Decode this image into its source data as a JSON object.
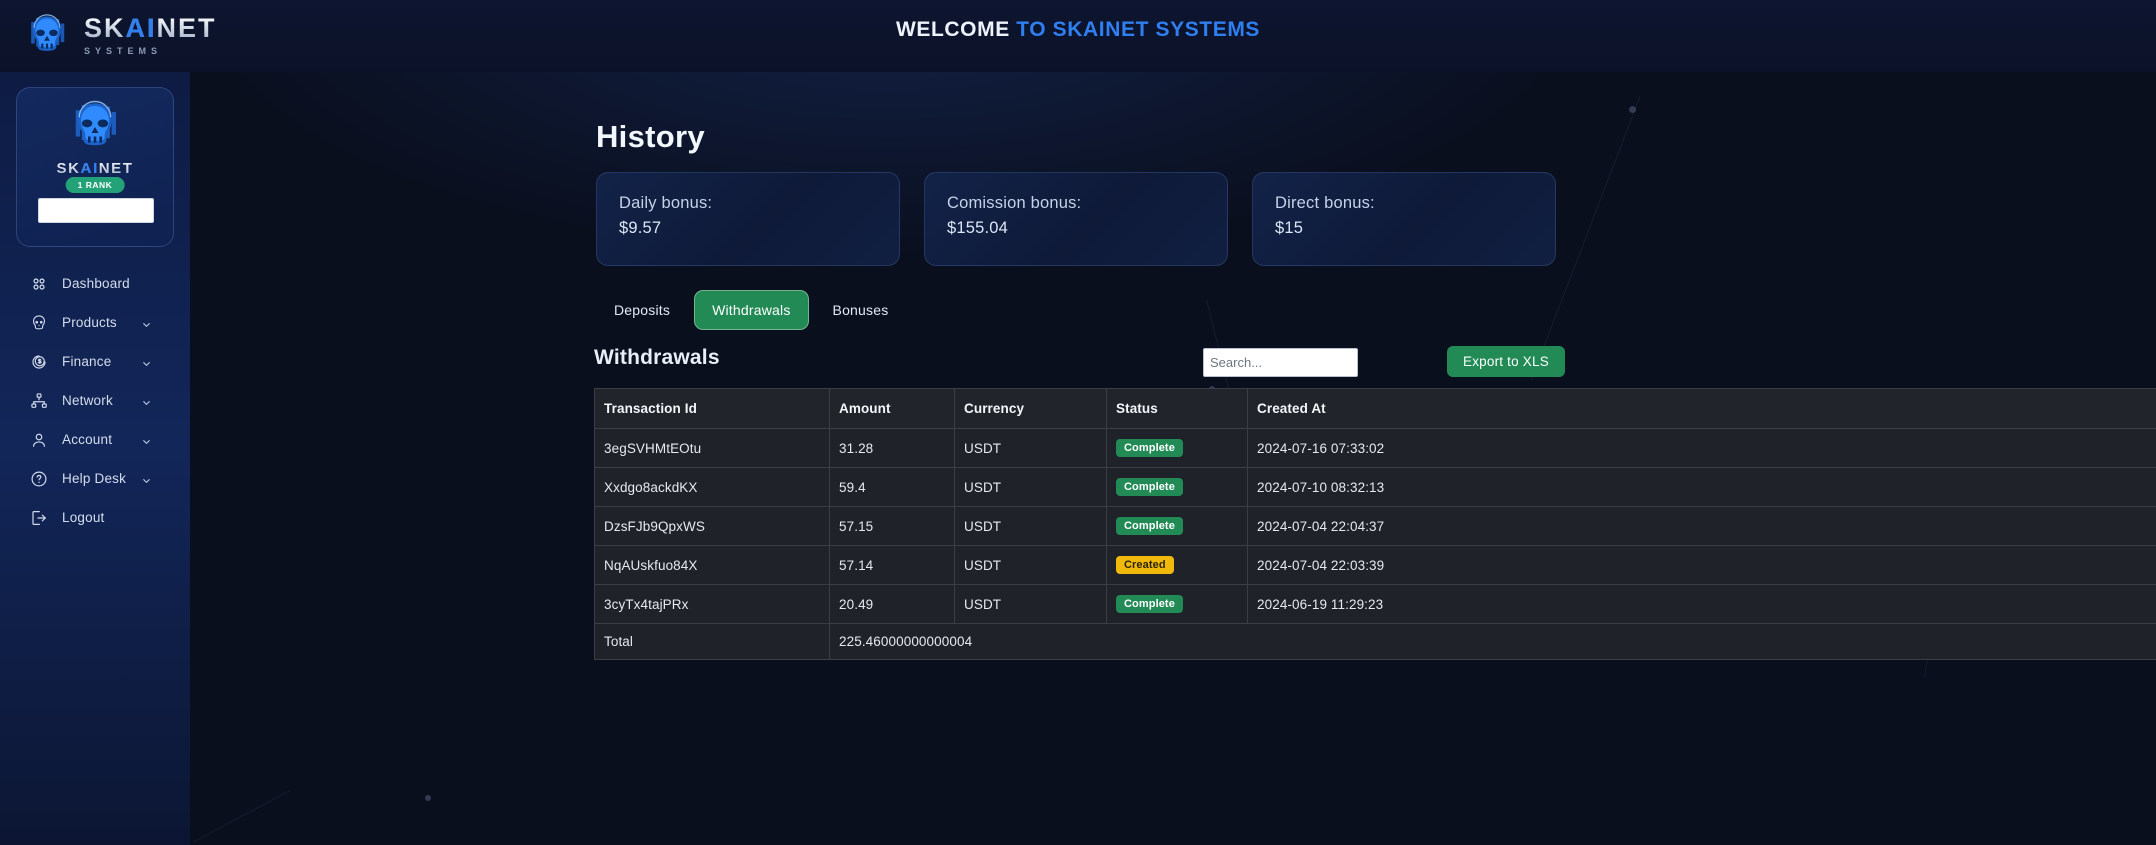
{
  "brand": {
    "name_part1": "SK",
    "name_ai": "AI",
    "name_part2": "NET",
    "subtitle": "SYSTEMS",
    "logo_icon": "skull-logo-icon"
  },
  "header": {
    "welcome_prefix": "WELCOME ",
    "welcome_highlight": "TO SKAINET SYSTEMS",
    "accent": "#2f7ff0"
  },
  "sidebar": {
    "profile": {
      "avatar_icon": "skull-avatar-icon",
      "name_part1": "SK",
      "name_ai": "AI",
      "name_part2": "NET",
      "rank_badge": "1 RANK",
      "input_value": "",
      "input_placeholder": ""
    },
    "items": [
      {
        "label": "Dashboard",
        "icon": "dashboard-grid-icon",
        "chevron": false
      },
      {
        "label": "Products",
        "icon": "skull-icon",
        "chevron": true
      },
      {
        "label": "Finance",
        "icon": "dollar-circle-icon",
        "chevron": true
      },
      {
        "label": "Network",
        "icon": "sitemap-icon",
        "chevron": true
      },
      {
        "label": "Account",
        "icon": "user-icon",
        "chevron": true
      },
      {
        "label": "Help Desk",
        "icon": "question-circle-icon",
        "chevron": true
      },
      {
        "label": "Logout",
        "icon": "logout-icon",
        "chevron": false
      }
    ]
  },
  "main": {
    "page_title": "History",
    "stat_cards": [
      {
        "label": "Daily bonus:",
        "value": "$9.57"
      },
      {
        "label": "Comission bonus:",
        "value": "$155.04"
      },
      {
        "label": "Direct bonus:",
        "value": "$15"
      }
    ],
    "tabs": [
      {
        "label": "Deposits",
        "active": false
      },
      {
        "label": "Withdrawals",
        "active": true
      },
      {
        "label": "Bonuses",
        "active": false
      }
    ],
    "section_title": "Withdrawals",
    "search": {
      "value": "",
      "placeholder": "Search..."
    },
    "export_label": "Export to XLS",
    "table": {
      "columns": [
        "Transaction Id",
        "Amount",
        "Currency",
        "Status",
        "Created At"
      ],
      "rows": [
        {
          "tx": "3egSVHMtEOtu",
          "amount": "31.28",
          "currency": "USDT",
          "status": "Complete",
          "status_kind": "complete",
          "created": "2024-07-16 07:33:02"
        },
        {
          "tx": "Xxdgo8ackdKX",
          "amount": "59.4",
          "currency": "USDT",
          "status": "Complete",
          "status_kind": "complete",
          "created": "2024-07-10 08:32:13"
        },
        {
          "tx": "DzsFJb9QpxWS",
          "amount": "57.15",
          "currency": "USDT",
          "status": "Complete",
          "status_kind": "complete",
          "created": "2024-07-04 22:04:37"
        },
        {
          "tx": "NqAUskfuo84X",
          "amount": "57.14",
          "currency": "USDT",
          "status": "Created",
          "status_kind": "created",
          "created": "2024-07-04 22:03:39"
        },
        {
          "tx": "3cyTx4tajPRx",
          "amount": "20.49",
          "currency": "USDT",
          "status": "Complete",
          "status_kind": "complete",
          "created": "2024-06-19 11:29:23"
        }
      ],
      "total": {
        "label": "Total",
        "value": "225.46000000000004"
      }
    }
  },
  "colors": {
    "green": "#228b55",
    "yellow": "#f0b90b",
    "sidebar_top": "#122659",
    "page_bg": "#0a0f1e"
  }
}
